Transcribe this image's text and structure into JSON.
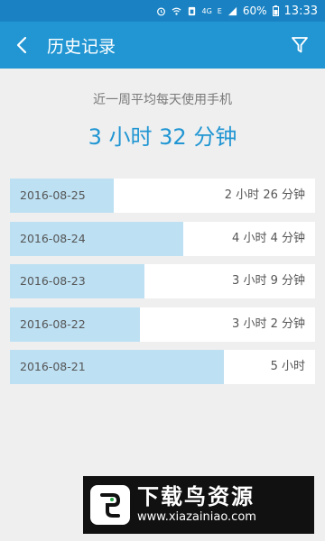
{
  "status_bar": {
    "network": "4G",
    "signal": "E",
    "battery": "60%",
    "time": "13:33",
    "icons": [
      "alarm-icon",
      "wifi-icon",
      "sim-icon",
      "signal-icon",
      "battery-icon"
    ]
  },
  "header": {
    "title": "历史记录",
    "back_icon": "back-arrow-icon",
    "filter_icon": "filter-icon"
  },
  "summary": {
    "label": "近一周平均每天使用手机",
    "value": "3 小时 32 分钟"
  },
  "records": [
    {
      "date": "2016-08-25",
      "duration": "2 小时 26 分钟",
      "minutes": 146
    },
    {
      "date": "2016-08-24",
      "duration": "4 小时 4 分钟",
      "minutes": 244
    },
    {
      "date": "2016-08-23",
      "duration": "3 小时 9 分钟",
      "minutes": 189
    },
    {
      "date": "2016-08-22",
      "duration": "3 小时 2 分钟",
      "minutes": 182
    },
    {
      "date": "2016-08-21",
      "duration": "5 小时",
      "minutes": 300
    }
  ],
  "colors": {
    "primary": "#2196d3",
    "status_bar": "#1a82c3",
    "bar_fill": "#bde0f3",
    "background": "#efefef"
  },
  "watermark": {
    "title": "下载鸟资源",
    "url": "www.xiazainiao.com"
  }
}
